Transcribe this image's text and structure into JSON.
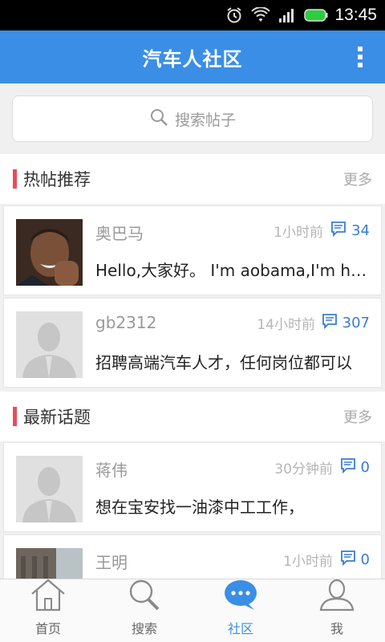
{
  "status": {
    "time": "13:45"
  },
  "header": {
    "title": "汽车人社区"
  },
  "search": {
    "placeholder": "搜索帖子"
  },
  "hot": {
    "title": "热帖推荐",
    "more": "更多",
    "posts": [
      {
        "author": "奥巴马",
        "time": "1小时前",
        "comments": "34",
        "snippet": "Hello,大家好。 I'm aobama,I'm here"
      },
      {
        "author": "gb2312",
        "time": "14小时前",
        "comments": "307",
        "snippet": "招聘高端汽车人才，任何岗位都可以"
      }
    ]
  },
  "latest": {
    "title": "最新话题",
    "more": "更多",
    "posts": [
      {
        "author": "蒋伟",
        "time": "30分钟前",
        "comments": "0",
        "snippet": "想在宝安找一油漆中工工作，"
      },
      {
        "author": "王明",
        "time": "1小时前",
        "comments": "0",
        "snippet": ""
      }
    ]
  },
  "tabs": [
    {
      "label": "首页",
      "icon": "home-icon"
    },
    {
      "label": "搜索",
      "icon": "search-icon"
    },
    {
      "label": "社区",
      "icon": "community-icon"
    },
    {
      "label": "我",
      "icon": "profile-icon"
    }
  ],
  "colors": {
    "primary": "#3a8ee6",
    "accent": "#e84d5b",
    "comment": "#3a7bd5"
  }
}
